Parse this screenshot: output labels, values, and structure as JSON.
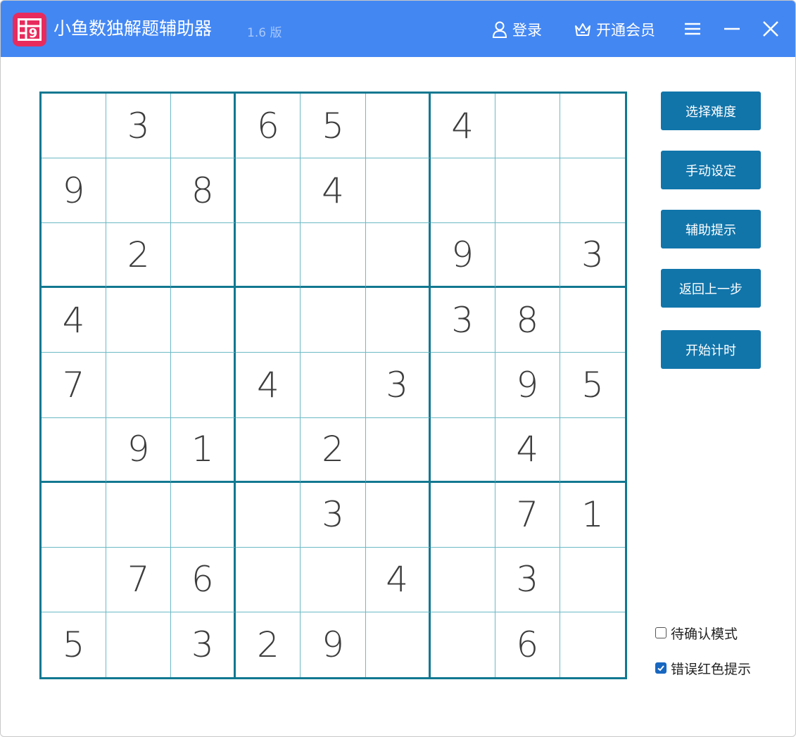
{
  "app": {
    "title": "小鱼数独解题辅助器",
    "version": "1.6 版",
    "icon_digit": "9"
  },
  "toolbar": {
    "login_label": "登录",
    "vip_label": "开通会员",
    "menu_icon": "hamburger-menu-icon",
    "minimize_icon": "minimize-icon",
    "close_icon": "close-icon"
  },
  "board": {
    "grid": [
      [
        "",
        "3",
        "",
        "6",
        "5",
        "",
        "4",
        "",
        ""
      ],
      [
        "9",
        "",
        "8",
        "",
        "4",
        "",
        "",
        "",
        ""
      ],
      [
        "",
        "2",
        "",
        "",
        "",
        "",
        "9",
        "",
        "3"
      ],
      [
        "4",
        "",
        "",
        "",
        "",
        "",
        "3",
        "8",
        ""
      ],
      [
        "7",
        "",
        "",
        "4",
        "",
        "3",
        "",
        "9",
        "5"
      ],
      [
        "",
        "9",
        "1",
        "",
        "2",
        "",
        "",
        "4",
        ""
      ],
      [
        "",
        "",
        "",
        "",
        "3",
        "",
        "",
        "7",
        "1"
      ],
      [
        "",
        "7",
        "6",
        "",
        "",
        "4",
        "",
        "3",
        ""
      ],
      [
        "5",
        "",
        "3",
        "2",
        "9",
        "",
        "",
        "6",
        ""
      ]
    ]
  },
  "actions": [
    {
      "label": "选择难度"
    },
    {
      "label": "手动设定"
    },
    {
      "label": "辅助提示"
    },
    {
      "label": "返回上一步"
    },
    {
      "label": "开始计时"
    }
  ],
  "options": [
    {
      "label": "待确认模式",
      "checked": false
    },
    {
      "label": "错误红色提示",
      "checked": true
    }
  ],
  "colors": {
    "titlebar": "#4387f3",
    "app_icon": "#e72b5d",
    "board_border": "#127891",
    "grid_line": "#6bb9c5",
    "button": "#1175aa",
    "checkbox_checked": "#1867c0"
  }
}
